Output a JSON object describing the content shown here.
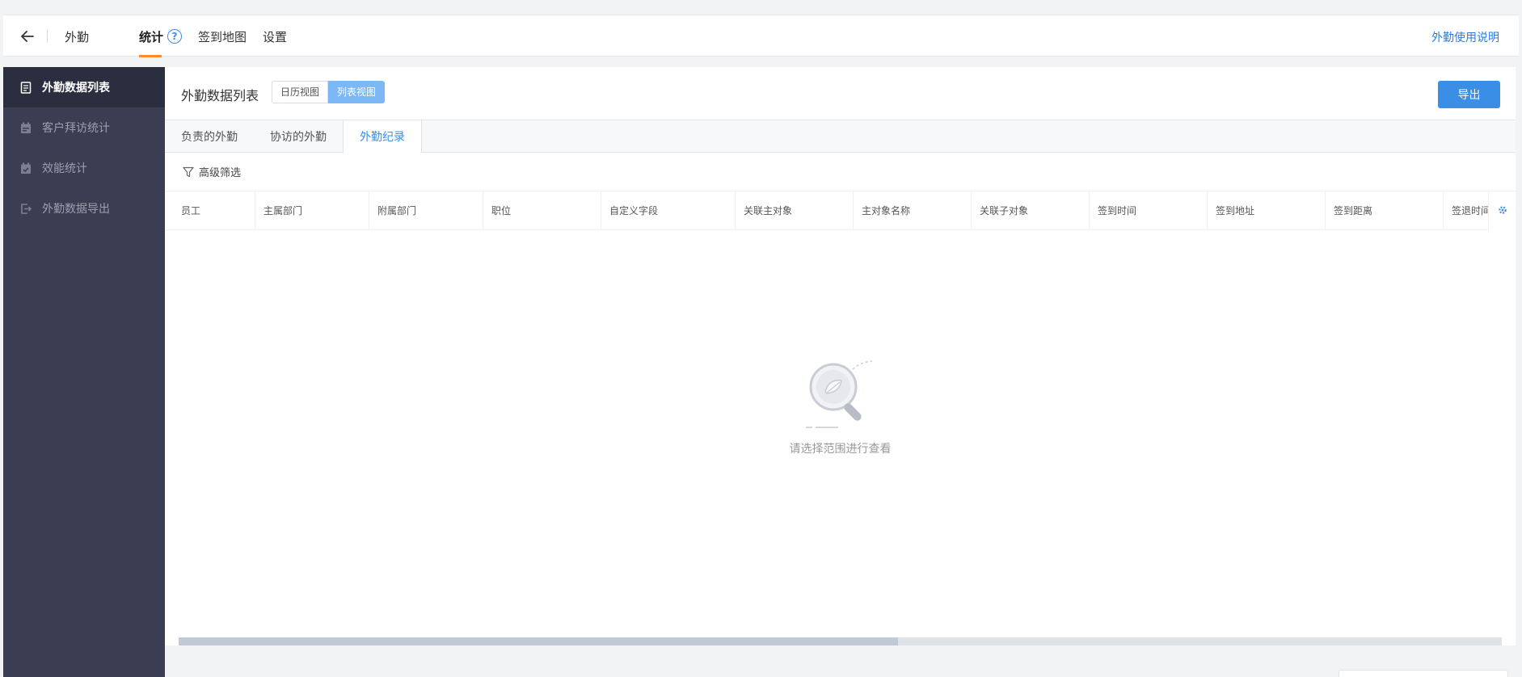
{
  "topbar": {
    "app_title": "外勤",
    "nav": [
      {
        "label": "统计",
        "active": true
      },
      {
        "label": "签到地图",
        "active": false
      },
      {
        "label": "设置",
        "active": false
      }
    ],
    "help_mark": "?",
    "usage_link": "外勤使用说明"
  },
  "sidebar": {
    "items": [
      {
        "label": "外勤数据列表",
        "icon": "document-icon",
        "active": true
      },
      {
        "label": "客户拜访统计",
        "icon": "calendar-icon",
        "active": false
      },
      {
        "label": "效能统计",
        "icon": "calendar-check-icon",
        "active": false
      },
      {
        "label": "外勤数据导出",
        "icon": "export-icon",
        "active": false
      }
    ]
  },
  "main": {
    "title": "外勤数据列表",
    "view_toggle": [
      "日历视图",
      "列表视图"
    ],
    "export_label": "导出",
    "tabs": [
      "负责的外勤",
      "协访的外勤",
      "外勤纪录"
    ],
    "active_tab": 2,
    "filter_label": "高级筛选",
    "columns": [
      "员工",
      "主属部门",
      "附属部门",
      "职位",
      "自定义字段",
      "关联主对象",
      "主对象名称",
      "关联子对象",
      "签到时间",
      "签到地址",
      "签到距离",
      "签退时间"
    ],
    "empty_text": "请选择范围进行查看"
  },
  "colors": {
    "accent": "#3a8ee6",
    "nav_underline": "#ff8b2b",
    "sidebar_bg": "#3b3e52",
    "sidebar_active": "#2b2e3f"
  }
}
